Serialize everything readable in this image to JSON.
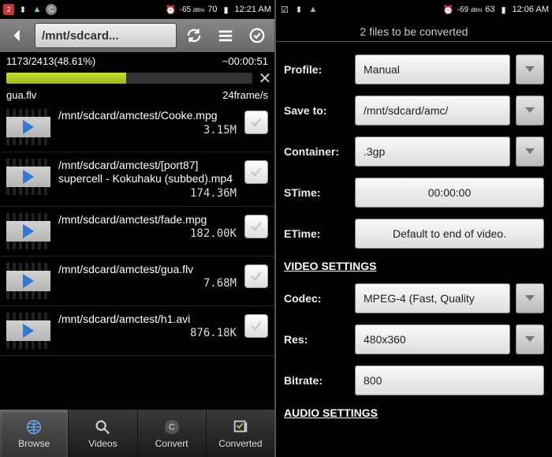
{
  "left": {
    "status": {
      "signal": "-65",
      "unit": "dBm",
      "battery": "70",
      "time": "12:21 AM"
    },
    "header": {
      "path": "/mnt/sdcard..."
    },
    "progress": {
      "counter": "1173/2413(48.61%)",
      "time": "~00:00:51",
      "pct": 48.61,
      "file": "gua.flv",
      "rate": "24frame/s"
    },
    "files": [
      {
        "path": "/mnt/sdcard/amctest/Cooke.mpg",
        "size": "3.15M"
      },
      {
        "path": "/mnt/sdcard/amctest/[port87] supercell - Kokuhaku (subbed).mp4",
        "size": "174.36M"
      },
      {
        "path": "/mnt/sdcard/amctest/fade.mpg",
        "size": "182.00K"
      },
      {
        "path": "/mnt/sdcard/amctest/gua.flv",
        "size": "7.68M"
      },
      {
        "path": "/mnt/sdcard/amctest/h1.avi",
        "size": "876.18K"
      }
    ],
    "tabs": [
      {
        "name": "Browse",
        "icon": "browse",
        "active": true
      },
      {
        "name": "Videos",
        "icon": "search",
        "active": false
      },
      {
        "name": "Convert",
        "icon": "convert",
        "active": false
      },
      {
        "name": "Converted",
        "icon": "done",
        "active": false
      }
    ]
  },
  "right": {
    "status": {
      "signal": "-69",
      "unit": "dBm",
      "battery": "63",
      "time": "12:06 AM"
    },
    "top": "2  files to be converted",
    "sections": {
      "video": "VIDEO SETTINGS",
      "audio": "AUDIO SETTINGS"
    },
    "labels": {
      "profile": "Profile:",
      "saveto": "Save to:",
      "container": "Container:",
      "stime": "STime:",
      "etime": "ETime:",
      "codec": "Codec:",
      "res": "Res:",
      "bitrate": "Bitrate:"
    },
    "values": {
      "profile": "Manual",
      "saveto": "/mnt/sdcard/amc/",
      "container": ".3gp",
      "stime": "00:00:00",
      "etime": "Default to end of video.",
      "codec": "MPEG-4 (Fast, Quality",
      "res": "480x360",
      "bitrate": "800"
    }
  }
}
